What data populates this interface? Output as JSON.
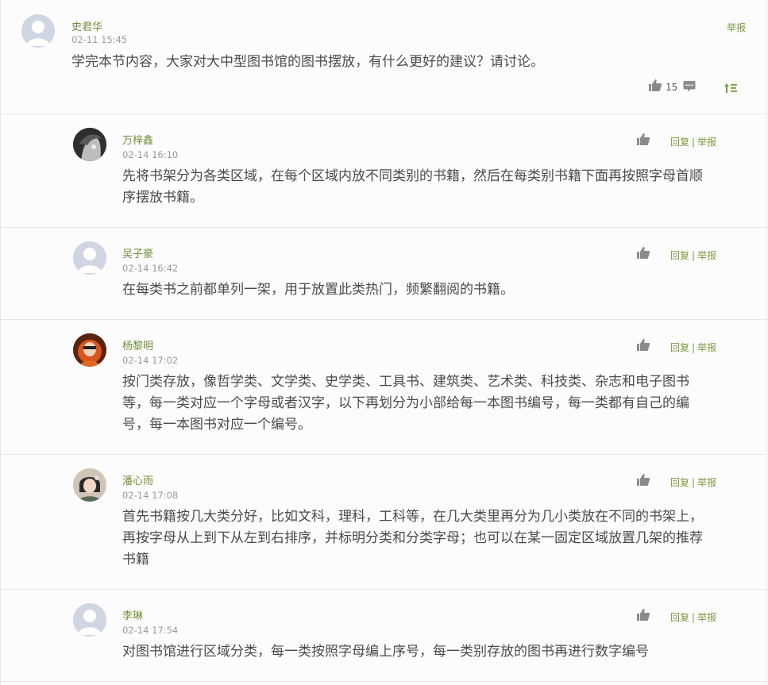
{
  "topic": {
    "author": "史君华",
    "time": "02-11 15:45",
    "content": "学完本节内容，大家对大中型图书馆的图书摆放，有什么更好的建议？请讨论。",
    "report_label": "举报",
    "like_count": "15",
    "like_icon": "thumbs-up-icon",
    "comment_icon": "comment-icon",
    "sort_icon": "sort-icon",
    "accent_color": "#7c9a3f"
  },
  "replies": [
    {
      "author": "万梓鑫",
      "time": "02-14 16:10",
      "content_lines": [
        "先将书架分为各类区域，在每个区域内放不同类别的书籍，然后在每类别书籍下面再按照字母首顺",
        "序摆放书籍。"
      ],
      "reply_label": "回复",
      "report_label": "举报"
    },
    {
      "author": "吴子豪",
      "time": "02-14 16:42",
      "content_lines": [
        "在每类书之前都单列一架，用于放置此类热门，频繁翻阅的书籍。"
      ],
      "reply_label": "回复",
      "report_label": "举报"
    },
    {
      "author": "杨黎明",
      "time": "02-14 17:02",
      "content_lines": [
        "按门类存放，像哲学类、文学类、史学类、工具书、建筑类、艺术类、科技类、杂志和电子图书",
        "等，每一类对应一个字母或者汉字，以下再划分为小部给每一本图书编号，每一类都有自己的编",
        "号，每一本图书对应一个编号。"
      ],
      "reply_label": "回复",
      "report_label": "举报"
    },
    {
      "author": "潘心雨",
      "time": "02-14 17:08",
      "content_lines": [
        "首先书籍按几大类分好，比如文科，理科，工科等，在几大类里再分为几小类放在不同的书架上，",
        "再按字母从上到下从左到右排序，并标明分类和分类字母；也可以在某一固定区域放置几架的推荐",
        "书籍"
      ],
      "reply_label": "回复",
      "report_label": "举报"
    },
    {
      "author": "李琳",
      "time": "02-14 17:54",
      "content_lines": [
        "对图书馆进行区域分类，每一类按照字母编上序号，每一类别存放的图书再进行数字编号"
      ],
      "reply_label": "回复",
      "report_label": "举报"
    }
  ]
}
